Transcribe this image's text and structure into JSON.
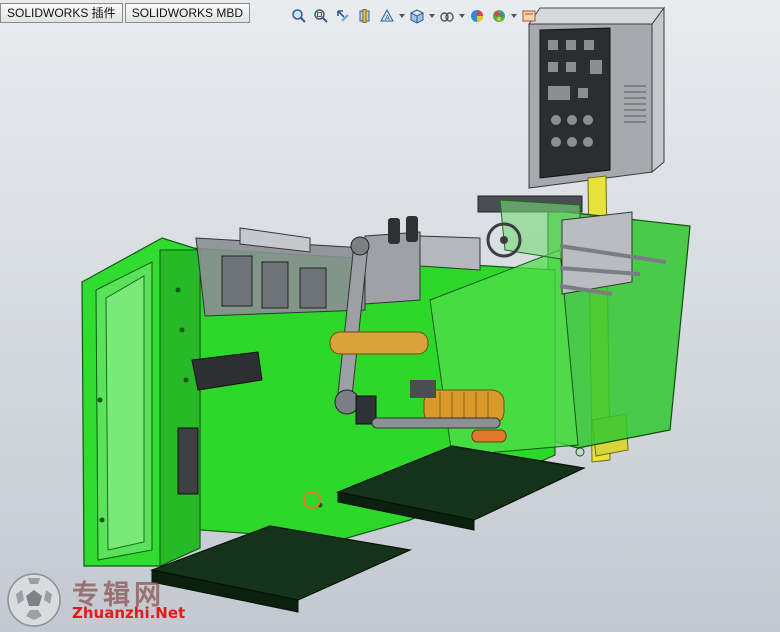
{
  "app": {
    "name": "SOLIDWORKS"
  },
  "command_manager": {
    "tabs": [
      {
        "label": "SOLIDWORKS 插件"
      },
      {
        "label": "SOLIDWORKS MBD"
      }
    ]
  },
  "heads_up_toolbar": {
    "icons": [
      "zoom-to-fit-icon",
      "zoom-to-area-icon",
      "previous-view-icon",
      "section-view-icon",
      "dynamic-annotation-view-icon",
      "view-orientation-icon",
      "display-style-icon",
      "hide-show-items-icon",
      "edit-appearance-icon",
      "apply-scene-icon",
      "view-settings-icon"
    ]
  },
  "model": {
    "description_icon": "packaging-machine-assembly"
  },
  "watermark": {
    "cn_text": "专辑网",
    "en_text": "Zhuanzhi.Net",
    "colors": {
      "cn": "#762824",
      "en": "#e01b1b"
    }
  },
  "colors": {
    "background_top": "#e9ecef",
    "background_bottom": "#c3c9d0",
    "frame_green": "#2fdc2f",
    "frame_green_dark": "#1a9a1a",
    "panel_grey": "#a9adb2",
    "support_yellow": "#e8e33a",
    "base_dark": "#16351a"
  }
}
